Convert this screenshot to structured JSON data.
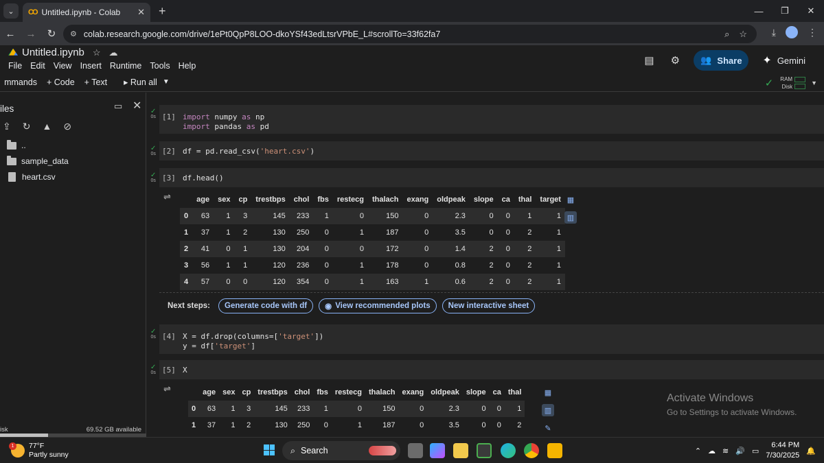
{
  "browser": {
    "tab_title": "Untitled.ipynb - Colab",
    "tab_logo": "CO",
    "url": "colab.research.google.com/drive/1ePt0QpP8LOO-dkoYSf43edLtsrVPbE_L#scrollTo=33f62fa7"
  },
  "colab": {
    "notebook_title": "Untitled.ipynb",
    "menu": [
      "File",
      "Edit",
      "View",
      "Insert",
      "Runtime",
      "Tools",
      "Help"
    ],
    "toolbar": {
      "commands": "mmands",
      "add_code": "+ Code",
      "add_text": "+ Text",
      "run_all": "▸ Run all"
    },
    "share_label": "Share",
    "gemini_label": "Gemini",
    "ram_label": "RAM",
    "disk_label": "Disk"
  },
  "sidebar": {
    "title": "iles",
    "items": [
      "..",
      "sample_data",
      "heart.csv"
    ],
    "disk_label": "isk",
    "disk_available": "69.52 GB available",
    "disk_used_fraction": 0.33
  },
  "cells": [
    {
      "exec": "[1]",
      "status": "0s",
      "lines": [
        [
          "import",
          " numpy ",
          "as",
          " np"
        ],
        [
          "import",
          " pandas ",
          "as",
          " pd"
        ]
      ]
    },
    {
      "exec": "[2]",
      "status": "0s",
      "code": "df = pd.read_csv(",
      "code_str": "'heart.csv'",
      "code_end": ")"
    },
    {
      "exec": "[3]",
      "status": "0s",
      "code": "df.head()"
    },
    {
      "exec": "[4]",
      "status": "0s",
      "line1": "X = df.drop(columns=[",
      "line1_str": "'target'",
      "line1_end": "])",
      "line2": "y = df[",
      "line2_str": "'target'",
      "line2_end": "]"
    },
    {
      "exec": "[5]",
      "status": "0s",
      "code": "X"
    }
  ],
  "df_head": {
    "columns": [
      "age",
      "sex",
      "cp",
      "trestbps",
      "chol",
      "fbs",
      "restecg",
      "thalach",
      "exang",
      "oldpeak",
      "slope",
      "ca",
      "thal",
      "target"
    ],
    "rows": [
      [
        "0",
        "63",
        "1",
        "3",
        "145",
        "233",
        "1",
        "0",
        "150",
        "0",
        "2.3",
        "0",
        "0",
        "1",
        "1"
      ],
      [
        "1",
        "37",
        "1",
        "2",
        "130",
        "250",
        "0",
        "1",
        "187",
        "0",
        "3.5",
        "0",
        "0",
        "2",
        "1"
      ],
      [
        "2",
        "41",
        "0",
        "1",
        "130",
        "204",
        "0",
        "0",
        "172",
        "0",
        "1.4",
        "2",
        "0",
        "2",
        "1"
      ],
      [
        "3",
        "56",
        "1",
        "1",
        "120",
        "236",
        "0",
        "1",
        "178",
        "0",
        "0.8",
        "2",
        "0",
        "2",
        "1"
      ],
      [
        "4",
        "57",
        "0",
        "0",
        "120",
        "354",
        "0",
        "1",
        "163",
        "1",
        "0.6",
        "2",
        "0",
        "2",
        "1"
      ]
    ]
  },
  "next_steps": {
    "label": "Next steps:",
    "btn1": "Generate code with df",
    "btn2": "View recommended plots",
    "btn3": "New interactive sheet"
  },
  "df_x": {
    "columns": [
      "age",
      "sex",
      "cp",
      "trestbps",
      "chol",
      "fbs",
      "restecg",
      "thalach",
      "exang",
      "oldpeak",
      "slope",
      "ca",
      "thal"
    ],
    "rows": [
      [
        "0",
        "63",
        "1",
        "3",
        "145",
        "233",
        "1",
        "0",
        "150",
        "0",
        "2.3",
        "0",
        "0",
        "1"
      ],
      [
        "1",
        "37",
        "1",
        "2",
        "130",
        "250",
        "0",
        "1",
        "187",
        "0",
        "3.5",
        "0",
        "0",
        "2"
      ]
    ]
  },
  "watermark": {
    "line1": "Activate Windows",
    "line2": "Go to Settings to activate Windows."
  },
  "taskbar": {
    "temp": "77°F",
    "weather": "Partly sunny",
    "weather_badge": "1",
    "search": "Search",
    "time": "6:44 PM",
    "date": "7/30/2025"
  }
}
